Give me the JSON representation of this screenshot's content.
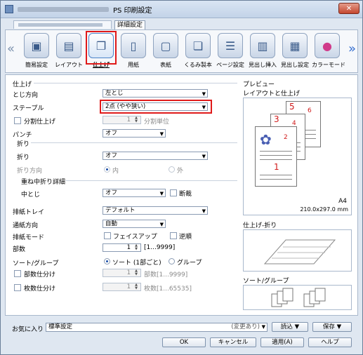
{
  "window": {
    "title": "PS 印刷設定",
    "close": "✕"
  },
  "tabs": {
    "detail": "詳細設定"
  },
  "toolbar": {
    "items": [
      {
        "label": "簡易設定",
        "icon": "quick-setup-icon"
      },
      {
        "label": "レイアウト",
        "icon": "layout-icon"
      },
      {
        "label": "仕上げ",
        "icon": "finishing-icon"
      },
      {
        "label": "用紙",
        "icon": "paper-icon"
      },
      {
        "label": "表紙",
        "icon": "cover-icon"
      },
      {
        "label": "くるみ製本",
        "icon": "perfect-binding-icon"
      },
      {
        "label": "ページ設定",
        "icon": "page-setup-icon"
      },
      {
        "label": "見出し挿入",
        "icon": "tab-insert-icon"
      },
      {
        "label": "見出し設定",
        "icon": "tab-settings-icon"
      },
      {
        "label": "カラーモード",
        "icon": "color-mode-icon"
      }
    ]
  },
  "finishing": {
    "section": "仕上げ",
    "binding_label": "とじ方向",
    "binding_value": "左とじ",
    "staple_label": "ステープル",
    "staple_value": "2点 (やや狭い)",
    "split_label": "分割仕上げ",
    "split_value": "1",
    "split_unit": "分割単位",
    "punch_label": "パンチ",
    "punch_value": "オフ",
    "fold_section": "折り",
    "fold_label": "折り",
    "fold_value": "オフ",
    "fold_dir_label": "折り方向",
    "fold_in": "内",
    "fold_out": "外",
    "saddle_section": "重ね中折り詳細",
    "saddle_label": "中とじ",
    "saddle_value": "オフ",
    "trim_label": "断裁",
    "tray_label": "排紙トレイ",
    "tray_value": "デフォルト",
    "feed_label": "通紙方向",
    "feed_value": "自動",
    "outmode_label": "排紙モード",
    "faceup_label": "フェイスアップ",
    "reverse_label": "逆順",
    "copies_label": "部数",
    "copies_value": "1",
    "copies_range": "[1...9999]",
    "sort_label": "ソート/グループ",
    "sort_value": "ソート (1部ごと)",
    "group_value": "グループ",
    "copy_split_label": "部数仕分け",
    "copy_split_value": "1",
    "copy_split_unit": "部数[1...9999]",
    "sheet_split_label": "枚数仕分け",
    "sheet_split_value": "1",
    "sheet_split_unit": "枚数[1...65535]"
  },
  "preview": {
    "title": "プレビュー",
    "layout_label": "レイアウトと仕上げ",
    "paper_size": "A4",
    "paper_dims": "210.0x297.0 mm",
    "finish_fold_label": "仕上げ-折り",
    "sort_group_label": "ソート/グループ",
    "page_numbers": [
      "1",
      "2",
      "3",
      "4",
      "5",
      "6"
    ]
  },
  "favorites": {
    "label": "お気に入り",
    "value": "標準設定",
    "changed": "(変更あり)",
    "load": "読込",
    "save": "保存"
  },
  "buttons": {
    "ok": "OK",
    "cancel": "キャンセル",
    "apply": "適用(A)",
    "help": "ヘルプ"
  }
}
